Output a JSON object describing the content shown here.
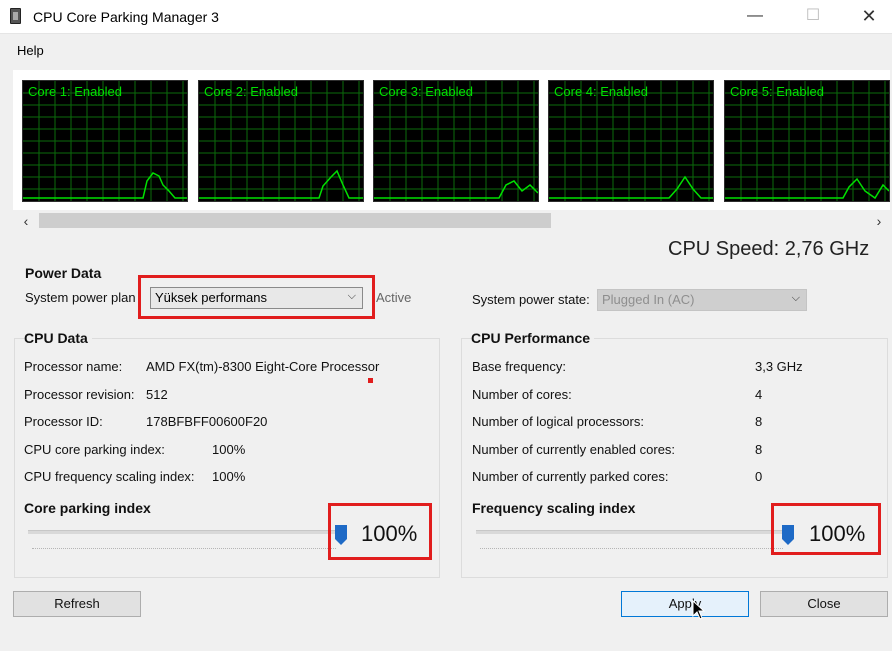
{
  "window": {
    "title": "CPU Core Parking Manager 3",
    "min_glyph": "—",
    "max_glyph": "☐",
    "close_glyph": "✕"
  },
  "menu": {
    "help": "Help"
  },
  "graphs": [
    {
      "label": "Core 1: Enabled"
    },
    {
      "label": "Core 2: Enabled"
    },
    {
      "label": "Core 3: Enabled"
    },
    {
      "label": "Core 4: Enabled"
    },
    {
      "label": "Core 5: Enabled"
    }
  ],
  "scroll": {
    "left": "‹",
    "right": "›"
  },
  "cpu_speed": "CPU Speed: 2,76 GHz",
  "power_data": {
    "title": "Power Data",
    "plan_label": "System power plan",
    "plan_value": "Yüksek performans",
    "active": "Active",
    "state_label": "System power state:",
    "state_value": "Plugged In (AC)"
  },
  "cpu_data": {
    "title": "CPU Data",
    "rows": [
      {
        "label": "Processor name:",
        "value": "AMD FX(tm)-8300 Eight-Core Processor"
      },
      {
        "label": "Processor revision:",
        "value": "512"
      },
      {
        "label": "Processor ID:",
        "value": "178BFBFF00600F20"
      },
      {
        "label": "CPU core parking index:",
        "value": "100%"
      },
      {
        "label": "CPU frequency scaling index:",
        "value": "100%"
      }
    ]
  },
  "cpu_performance": {
    "title": "CPU Performance",
    "rows": [
      {
        "label": "Base frequency:",
        "value": "3,3 GHz"
      },
      {
        "label": "Number of cores:",
        "value": "4"
      },
      {
        "label": "Number of logical processors:",
        "value": "8"
      },
      {
        "label": "Number of currently enabled cores:",
        "value": "8"
      },
      {
        "label": "Number of currently parked cores:",
        "value": "0"
      }
    ]
  },
  "core_parking_index": {
    "title": "Core parking index",
    "value": "100%",
    "level": 1.0
  },
  "frequency_scaling_index": {
    "title": "Frequency scaling index",
    "value": "100%",
    "level": 1.0
  },
  "buttons": {
    "refresh": "Refresh",
    "apply": "Apply",
    "close": "Close"
  },
  "colors": {
    "graph_line": "#00e000",
    "highlight": "#e11d1d",
    "accent": "#1e6ac6"
  }
}
